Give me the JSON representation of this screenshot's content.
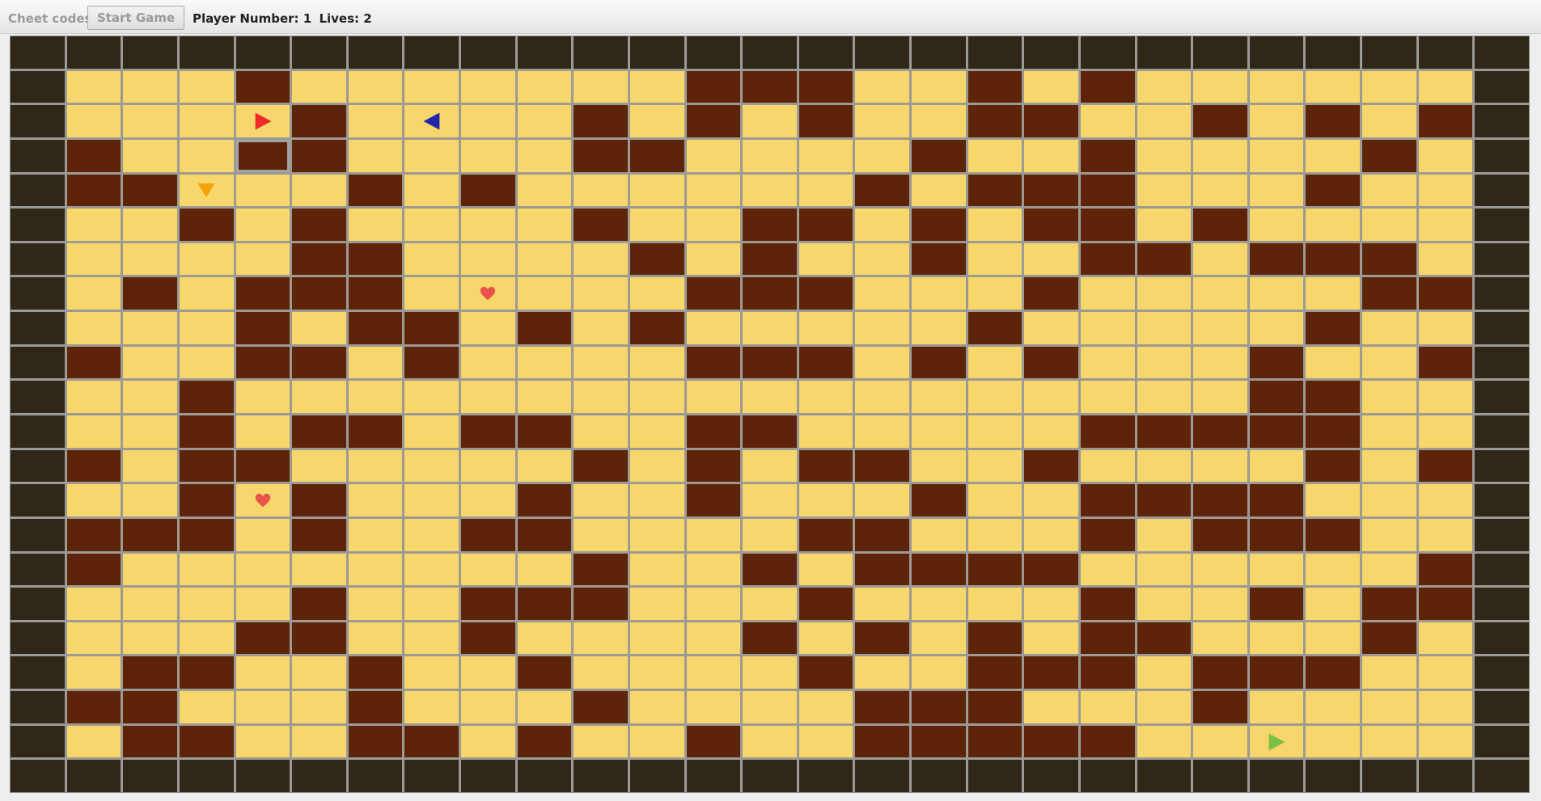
{
  "toolbar": {
    "cheat_label": "Cheet codes",
    "start_label": "Start Game",
    "player_label": "Player Number: 1",
    "lives_label": "Lives: 2"
  },
  "board": {
    "columns": 27,
    "rows": 22,
    "grid": [
      "EEEEEEEEEEEEEEEEEEEEEEEEEEE",
      "EFFFWFFFFFFFWWWFFWFWFFFFFFE",
      "EFFFFWFFFFWFWFWFFWWFFWFWFWE",
      "EWFFWWFFFFWWFFFFWFFWFFFFWFE",
      "EWWFFFWFWFFFFFFWFWWWFFFWFFE",
      "EFFWFWFFFFWFFWWFWFWWFWFFFFE",
      "EFFFFWWFFFFWFWFFWFFWWFWWWFE",
      "EFWFWWWFFFFFWWWFFFWFFFFFWWE",
      "EFFFWFWWFWFWFFFFFWFFFFFWFFE",
      "EWFFWWFWFFFFWWWFWFWFFFWFFWE",
      "EFFWFFFFFFFFFFFFFFFFFFWWFFE",
      "EFFWFWWFWWFFWWFFFFFWWWWWFFE",
      "EWFWWFFFFFWFWFWWFFWFFFFWFWE",
      "EFFWFWFFFWFFWFFFWFFWWWWFFFE",
      "EWWWFWFFWWFFFFWWFFFWFWWWFFE",
      "EWFFFFFFFFWFFWFWWWWFFFFFFWE",
      "EFFFFWFFWWWFFFWFFFFWFFWFWWE",
      "EFFFWWFFWFFFFWFWFWFWWFFFWFE",
      "EFWWFFWFFWFFFFWFFWWWFWWWFFE",
      "EWWFFFWFFFWFFFFWWWFFFWFFFFE",
      "EFWWFFWWFWFFWFFWWWWWFFFFFFE",
      "EEEEEEEEEEEEEEEEEEEEEEEEEEE"
    ],
    "selected_cell": {
      "row": 3,
      "col": 4
    },
    "pieces": [
      {
        "name": "red-arrow-right-icon",
        "row": 2,
        "col": 4,
        "shape": "arrow-right",
        "color": "#ee2a2a"
      },
      {
        "name": "blue-arrow-left-icon",
        "row": 2,
        "col": 7,
        "shape": "arrow-left",
        "color": "#2226aa"
      },
      {
        "name": "orange-arrow-down-icon",
        "row": 4,
        "col": 3,
        "shape": "arrow-down",
        "color": "#f5a30a"
      },
      {
        "name": "green-arrow-right-icon",
        "row": 20,
        "col": 22,
        "shape": "arrow-right",
        "color": "#7bc043"
      },
      {
        "name": "heart-icon",
        "row": 7,
        "col": 8,
        "shape": "heart",
        "color": "#e8544a"
      },
      {
        "name": "heart-icon",
        "row": 13,
        "col": 4,
        "shape": "heart",
        "color": "#e8544a"
      }
    ],
    "colors": {
      "edge": "#2f2718",
      "floor": "#f7d66b",
      "wall": "#5e2409",
      "grid_line": "#9c9a94"
    }
  }
}
